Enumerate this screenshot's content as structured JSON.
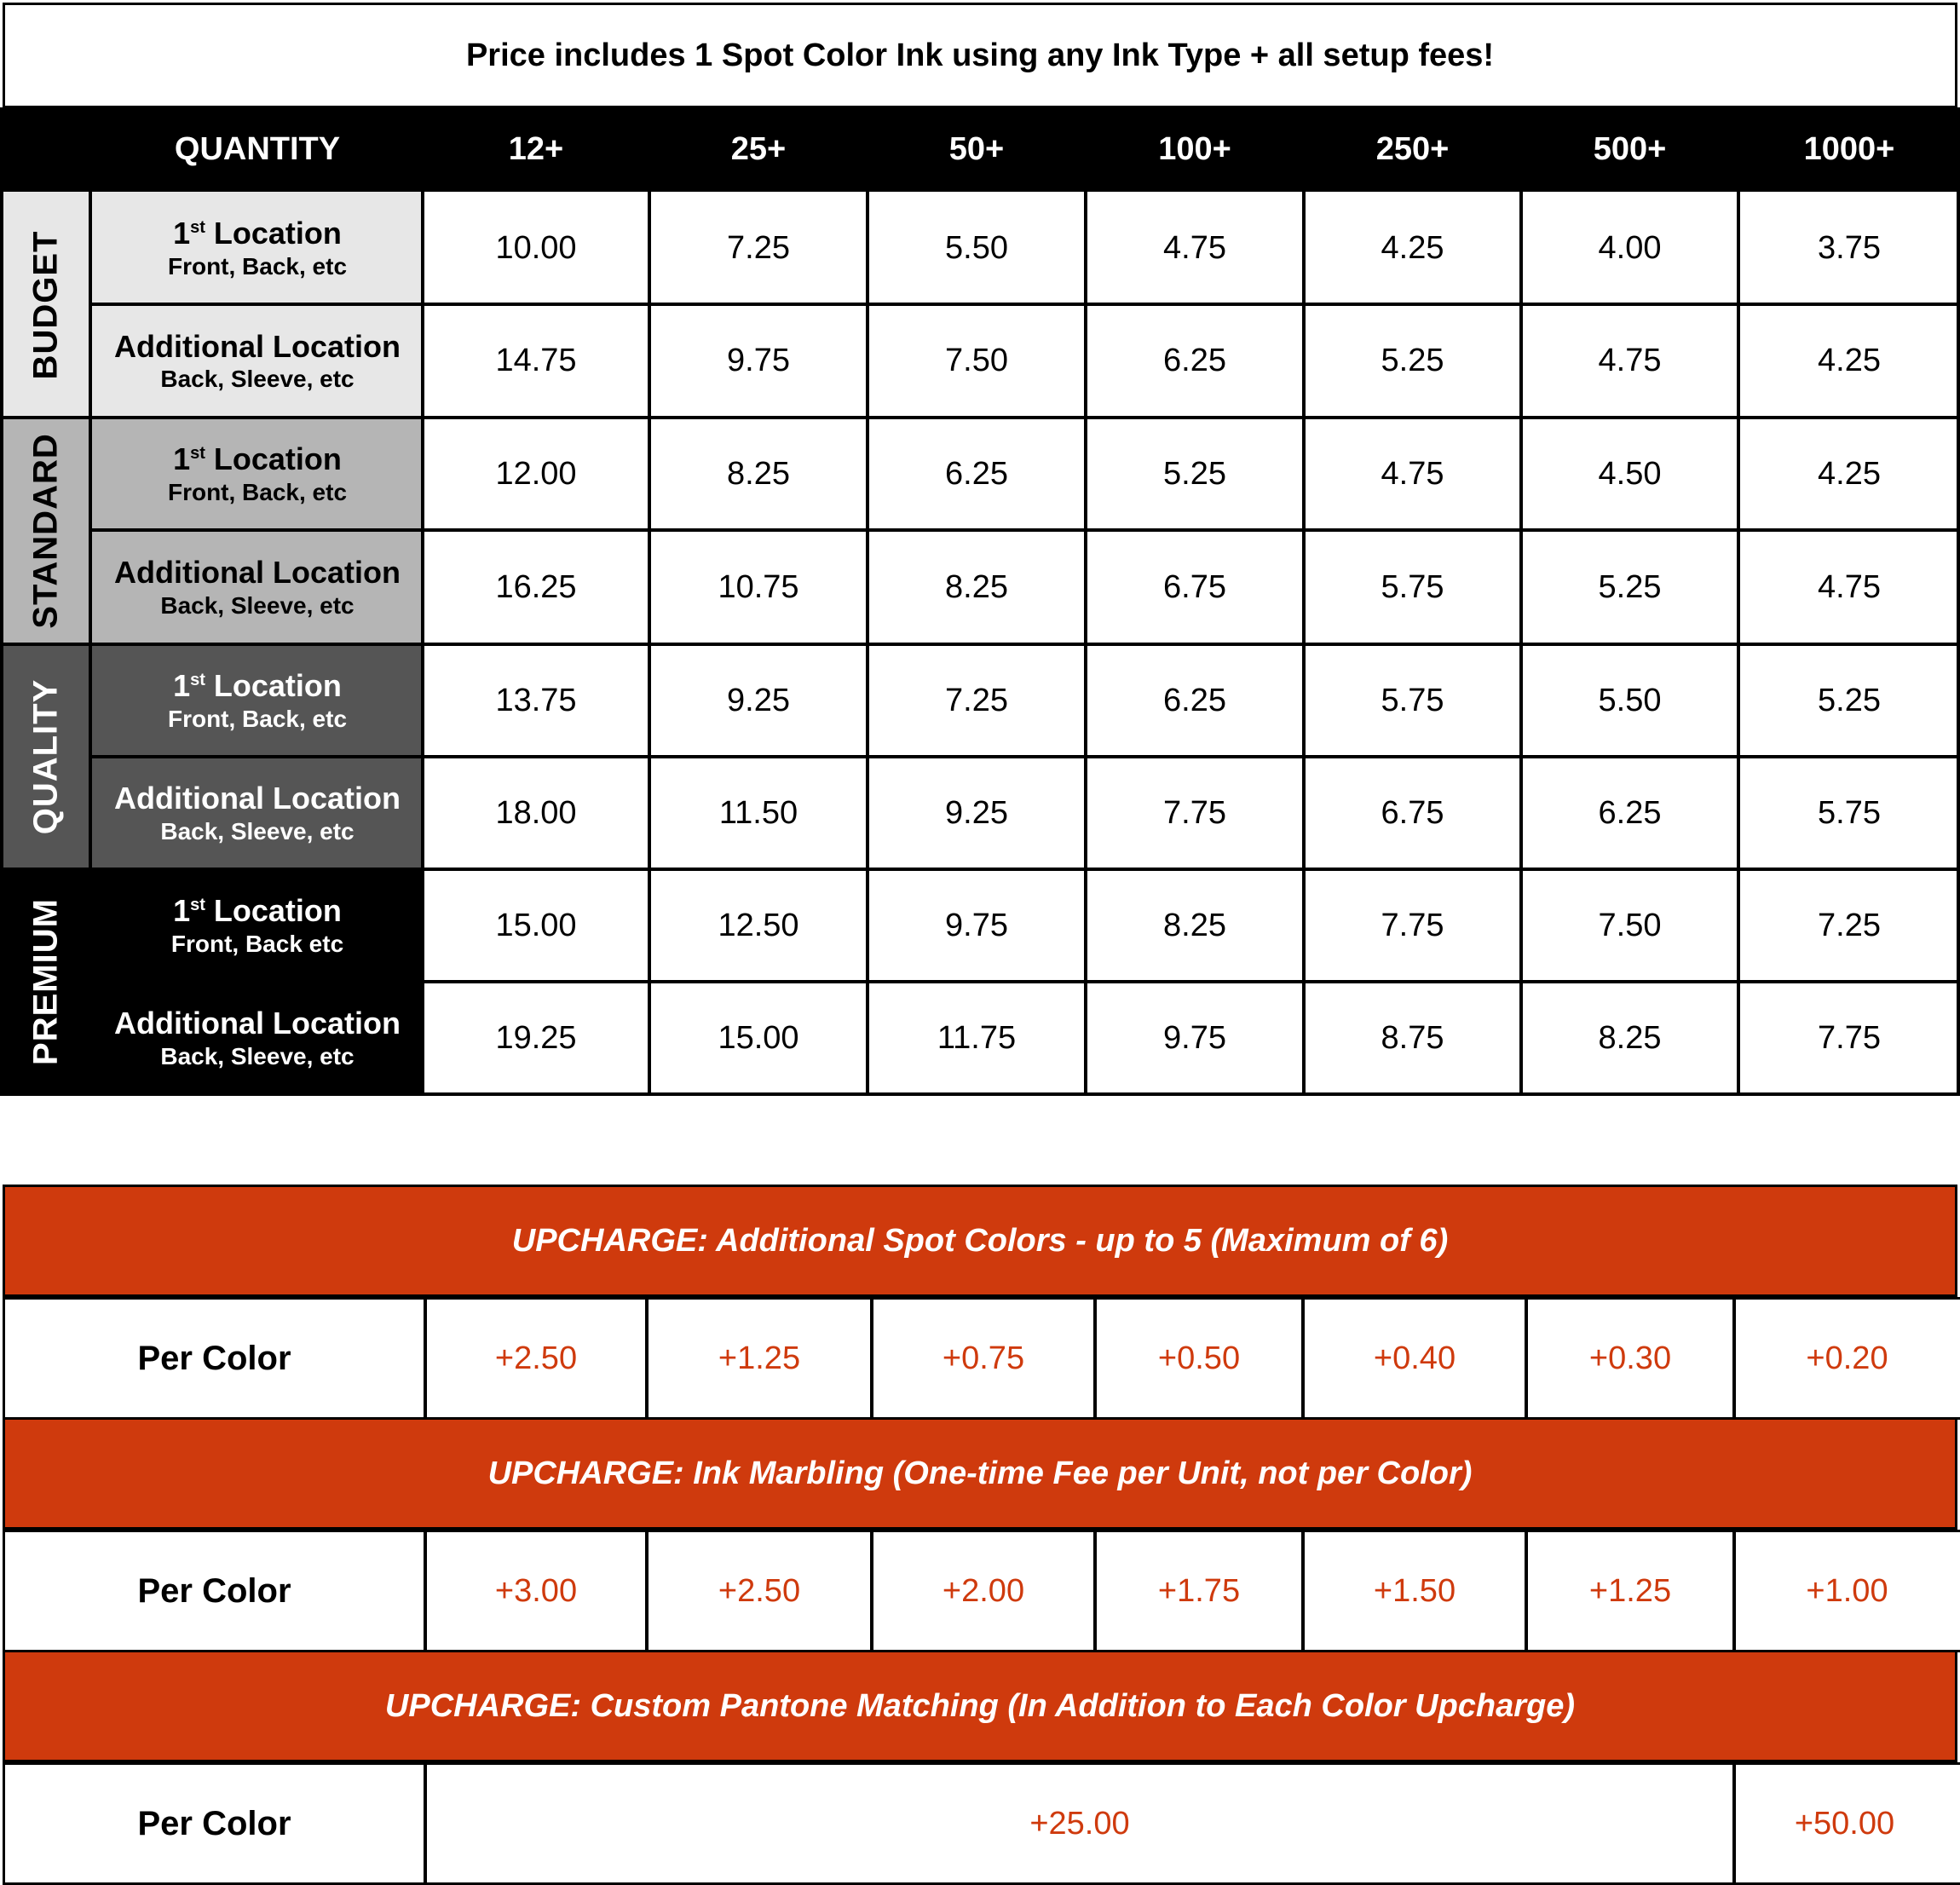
{
  "title": "Price includes 1 Spot Color Ink using any Ink Type + all setup fees!",
  "header": {
    "quantity_label": "QUANTITY",
    "tiers": [
      "12+",
      "25+",
      "50+",
      "100+",
      "250+",
      "500+",
      "1000+"
    ]
  },
  "colors": {
    "budget": "#e7e7e7",
    "standard": "#b5b5b5",
    "quality": "#555555",
    "premium": "#000000",
    "upcharge": "#cf3a0d"
  },
  "pricing": [
    {
      "tier": "BUDGET",
      "rows": [
        {
          "main": "1",
          "sup": "st",
          "main_rest": " Location",
          "sub": "Front, Back, etc",
          "prices": [
            "10.00",
            "7.25",
            "5.50",
            "4.75",
            "4.25",
            "4.00",
            "3.75"
          ]
        },
        {
          "main": "Additional Location",
          "sub": "Back, Sleeve, etc",
          "prices": [
            "14.75",
            "9.75",
            "7.50",
            "6.25",
            "5.25",
            "4.75",
            "4.25"
          ]
        }
      ]
    },
    {
      "tier": "STANDARD",
      "rows": [
        {
          "main": "1",
          "sup": "st",
          "main_rest": " Location",
          "sub": "Front, Back, etc",
          "prices": [
            "12.00",
            "8.25",
            "6.25",
            "5.25",
            "4.75",
            "4.50",
            "4.25"
          ]
        },
        {
          "main": "Additional Location",
          "sub": "Back, Sleeve, etc",
          "prices": [
            "16.25",
            "10.75",
            "8.25",
            "6.75",
            "5.75",
            "5.25",
            "4.75"
          ]
        }
      ]
    },
    {
      "tier": "QUALITY",
      "rows": [
        {
          "main": "1",
          "sup": "st",
          "main_rest": " Location",
          "sub": "Front, Back, etc",
          "prices": [
            "13.75",
            "9.25",
            "7.25",
            "6.25",
            "5.75",
            "5.50",
            "5.25"
          ]
        },
        {
          "main": "Additional Location",
          "sub": "Back, Sleeve, etc",
          "prices": [
            "18.00",
            "11.50",
            "9.25",
            "7.75",
            "6.75",
            "6.25",
            "5.75"
          ]
        }
      ]
    },
    {
      "tier": "PREMIUM",
      "rows": [
        {
          "main": "1",
          "sup": "st",
          "main_rest": " Location",
          "sub": "Front, Back etc",
          "prices": [
            "15.00",
            "12.50",
            "9.75",
            "8.25",
            "7.75",
            "7.50",
            "7.25"
          ]
        },
        {
          "main": "Additional Location",
          "sub": "Back, Sleeve, etc",
          "prices": [
            "19.25",
            "15.00",
            "11.75",
            "9.75",
            "8.75",
            "8.25",
            "7.75"
          ]
        }
      ]
    }
  ],
  "upcharges": [
    {
      "title": "UPCHARGE: Additional Spot Colors - up to 5 (Maximum of 6)",
      "label": "Per Color",
      "values": [
        "+2.50",
        "+1.25",
        "+0.75",
        "+0.50",
        "+0.40",
        "+0.30",
        "+0.20"
      ]
    },
    {
      "title": "UPCHARGE: Ink Marbling (One-time Fee per Unit, not per Color)",
      "label": "Per Color",
      "values": [
        "+3.00",
        "+2.50",
        "+2.00",
        "+1.75",
        "+1.50",
        "+1.25",
        "+1.00"
      ]
    },
    {
      "title": "UPCHARGE: Custom Pantone Matching (In Addition to Each Color Upcharge)",
      "label": "Per Color",
      "values": [
        "+25.00",
        "+50.00"
      ]
    }
  ]
}
